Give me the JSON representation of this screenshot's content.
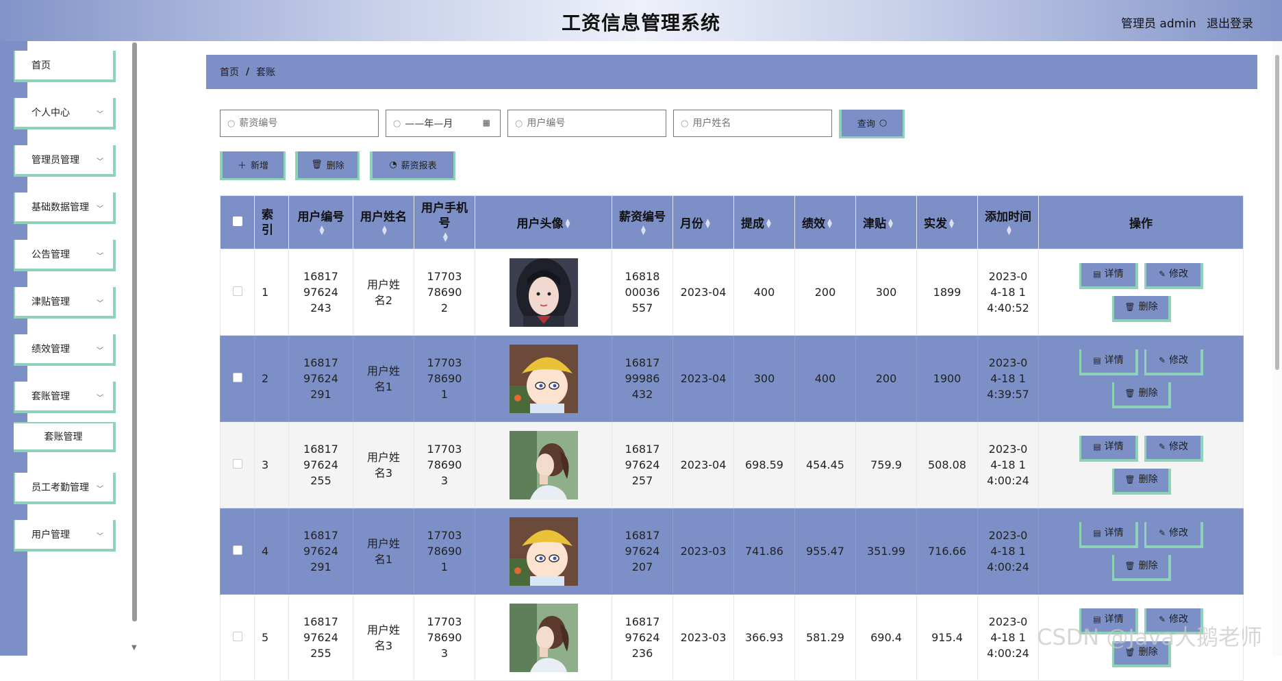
{
  "header": {
    "title": "工资信息管理系统",
    "admin_text": "管理员 admin",
    "logout_label": "退出登录"
  },
  "sidebar": {
    "items": [
      {
        "label": "首页",
        "has_children": false
      },
      {
        "label": "个人中心",
        "has_children": true
      },
      {
        "label": "管理员管理",
        "has_children": true
      },
      {
        "label": "基础数据管理",
        "has_children": true
      },
      {
        "label": "公告管理",
        "has_children": true
      },
      {
        "label": "津贴管理",
        "has_children": true
      },
      {
        "label": "绩效管理",
        "has_children": true
      },
      {
        "label": "套账管理",
        "has_children": true
      },
      {
        "label": "员工考勤管理",
        "has_children": true
      },
      {
        "label": "用户管理",
        "has_children": true
      }
    ],
    "sub_item": "套账管理"
  },
  "breadcrumb": {
    "home": "首页",
    "separator": "/",
    "current": "套账"
  },
  "search": {
    "salary_no_placeholder": "薪资编号",
    "month_placeholder": "——年—月",
    "user_no_placeholder": "用户编号",
    "user_name_placeholder": "用户姓名",
    "query_label": "查询"
  },
  "actions": {
    "add_label": "新增",
    "delete_label": "删除",
    "report_label": "薪资报表"
  },
  "table": {
    "headers": {
      "index": "索引",
      "user_no": "用户编号",
      "user_name": "用户姓名",
      "user_phone": "用户手机号",
      "avatar": "用户头像",
      "salary_no": "薪资编号",
      "month": "月份",
      "commission": "提成",
      "performance": "绩效",
      "allowance": "津贴",
      "actual": "实发",
      "added_time": "添加时间",
      "ops": "操作"
    },
    "row_buttons": {
      "detail": "详情",
      "edit": "修改",
      "delete": "删除"
    },
    "rows": [
      {
        "index": "1",
        "user_no": "1681797624243",
        "user_name": "用户姓名2",
        "phone": "17703786902",
        "avatar": "portrait-dark-hair",
        "salary_no": "1681800036557",
        "month": "2023-04",
        "commission": "400",
        "performance": "200",
        "allowance": "300",
        "actual": "1899",
        "time": "2023-04-18 14:40:52"
      },
      {
        "index": "2",
        "user_no": "1681797624291",
        "user_name": "用户姓名1",
        "phone": "17703786901",
        "avatar": "cartoon-yellow-hat",
        "salary_no": "1681799986432",
        "month": "2023-04",
        "commission": "300",
        "performance": "400",
        "allowance": "200",
        "actual": "1900",
        "time": "2023-04-18 14:39:57"
      },
      {
        "index": "3",
        "user_no": "1681797624255",
        "user_name": "用户姓名3",
        "phone": "17703786903",
        "avatar": "profile-ponytail",
        "salary_no": "1681797624257",
        "month": "2023-04",
        "commission": "698.59",
        "performance": "454.45",
        "allowance": "759.9",
        "actual": "508.08",
        "time": "2023-04-18 14:00:24"
      },
      {
        "index": "4",
        "user_no": "1681797624291",
        "user_name": "用户姓名1",
        "phone": "17703786901",
        "avatar": "cartoon-yellow-hat",
        "salary_no": "1681797624207",
        "month": "2023-03",
        "commission": "741.86",
        "performance": "955.47",
        "allowance": "351.99",
        "actual": "716.66",
        "time": "2023-04-18 14:00:24"
      },
      {
        "index": "5",
        "user_no": "1681797624255",
        "user_name": "用户姓名3",
        "phone": "17703786903",
        "avatar": "profile-ponytail",
        "salary_no": "1681797624236",
        "month": "2023-03",
        "commission": "366.93",
        "performance": "581.29",
        "allowance": "690.4",
        "actual": "915.4",
        "time": "2023-04-18 14:00:24"
      }
    ]
  },
  "watermark": "CSDN @Java大鹅老师",
  "colors": {
    "primary": "#7c8fc6",
    "accent_border": "#8ed3b9",
    "row_grey": "#f4f4f4"
  }
}
